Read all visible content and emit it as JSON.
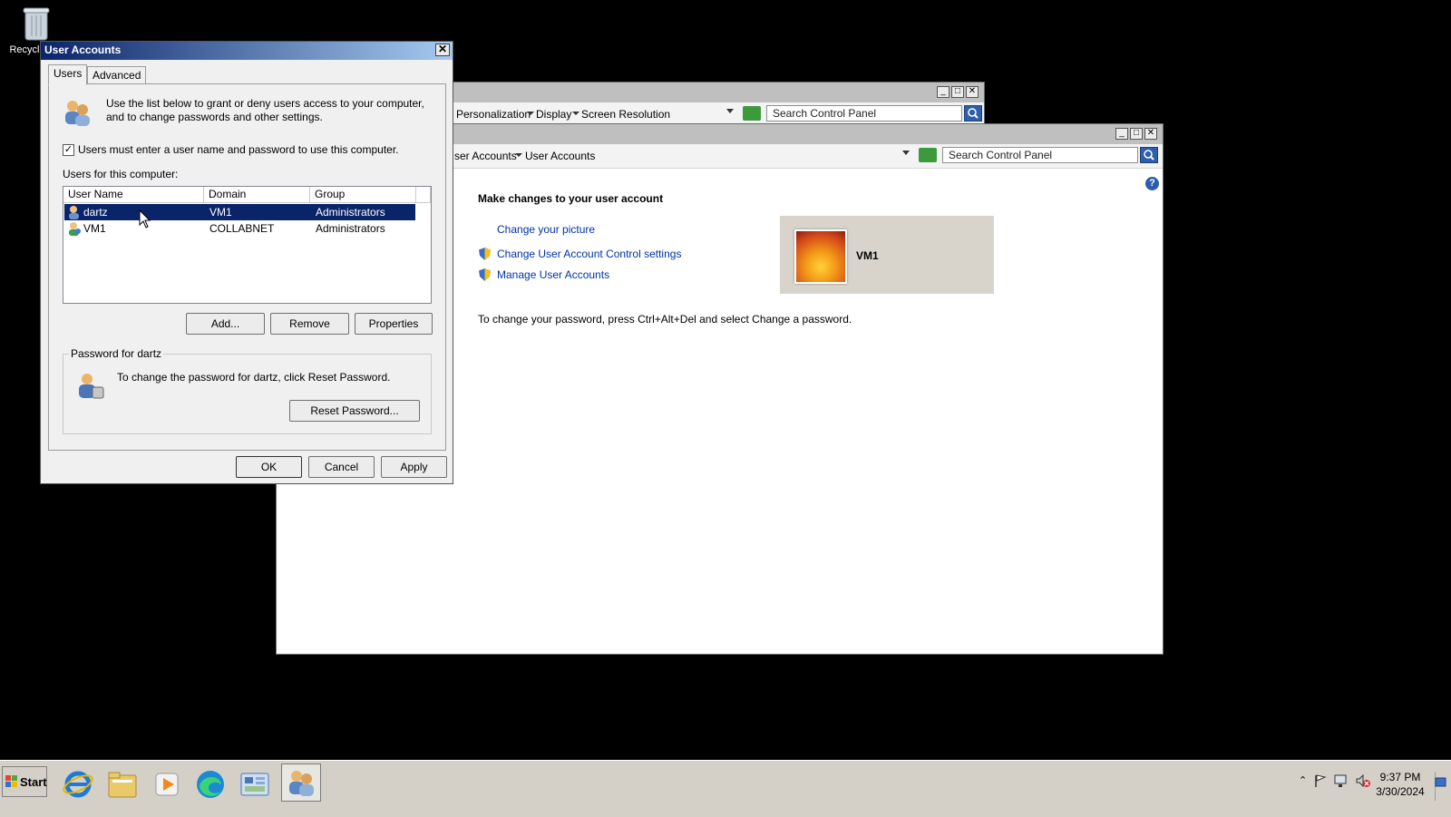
{
  "desktop": {
    "recycle_bin_label": "Recycle"
  },
  "back_window": {
    "breadcrumb": [
      "Personalization",
      "Display",
      "Screen Resolution"
    ],
    "search_placeholder": "Search Control Panel"
  },
  "cp_window": {
    "breadcrumb": [
      "ser Accounts",
      "User Accounts"
    ],
    "search_placeholder": "Search Control Panel",
    "heading": "Make changes to your user account",
    "links": {
      "change_picture": "Change your picture",
      "uac_settings": "Change User Account Control settings",
      "manage_accounts": "Manage User Accounts"
    },
    "account_name": "VM1",
    "password_note": "To change your password, press Ctrl+Alt+Del and select Change a password."
  },
  "dialog": {
    "title": "User Accounts",
    "tabs": [
      "Users",
      "Advanced"
    ],
    "intro": "Use the list below to grant or deny users access to your computer, and to change passwords and other settings.",
    "checkbox_label": "Users must enter a user name and password to use this computer.",
    "checkbox_checked": true,
    "users_label": "Users for this computer:",
    "columns": [
      "User Name",
      "Domain",
      "Group"
    ],
    "rows": [
      {
        "name": "dartz",
        "domain": "VM1",
        "group": "Administrators",
        "selected": true
      },
      {
        "name": "VM1",
        "domain": "COLLABNET",
        "group": "Administrators",
        "selected": false
      }
    ],
    "buttons": {
      "add": "Add...",
      "remove": "Remove",
      "properties": "Properties",
      "reset": "Reset Password...",
      "ok": "OK",
      "cancel": "Cancel",
      "apply": "Apply"
    },
    "password_group_label": "Password for dartz",
    "password_text": "To change the password for dartz, click Reset Password."
  },
  "taskbar": {
    "start_label": "Start",
    "time": "9:37 PM",
    "date": "3/30/2024"
  },
  "colors": {
    "selection": "#0a246a",
    "link": "#0033a6",
    "desktop": "#000000"
  }
}
